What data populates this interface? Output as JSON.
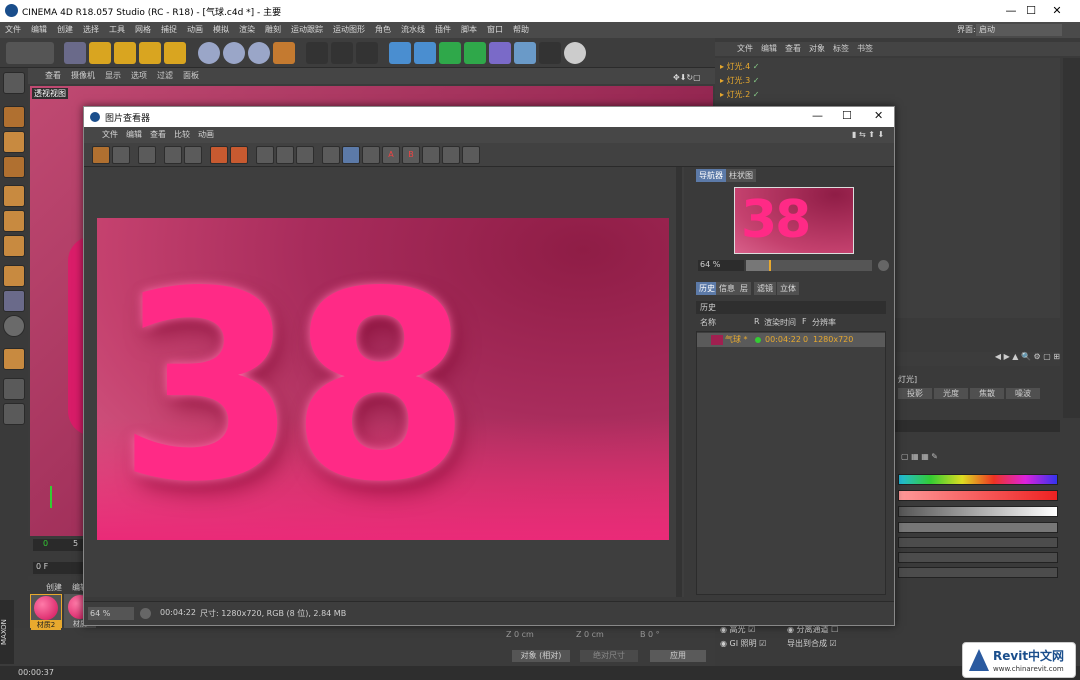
{
  "window": {
    "title": "CINEMA 4D R18.057 Studio (RC - R18) - [气球.c4d *] - 主要",
    "minimize": "—",
    "maximize": "☐",
    "close": "✕"
  },
  "menubar": {
    "items": [
      "文件",
      "编辑",
      "创建",
      "选择",
      "工具",
      "网格",
      "捕捉",
      "动画",
      "模拟",
      "渲染",
      "雕刻",
      "运动跟踪",
      "运动图形",
      "角色",
      "流水线",
      "插件",
      "脚本",
      "窗口",
      "帮助"
    ],
    "interface_label": "界面:",
    "interface_value": "启动"
  },
  "viewport": {
    "menu": [
      "查看",
      "摄像机",
      "显示",
      "选项",
      "过滤",
      "面板"
    ],
    "label": "透视视图"
  },
  "object_manager": {
    "menu": [
      "文件",
      "编辑",
      "查看",
      "对象",
      "标签",
      "书签"
    ],
    "objects": [
      "灯光.4",
      "灯光.3",
      "灯光.2"
    ]
  },
  "picture_viewer": {
    "title": "图片查看器",
    "menu": [
      "文件",
      "编辑",
      "查看",
      "比较",
      "动画"
    ],
    "nav_tabs": [
      "导航器",
      "柱状图"
    ],
    "zoom": "64 %",
    "info_tabs": [
      "历史",
      "信息",
      "层",
      "滤镜",
      "立体"
    ],
    "history_label": "历史",
    "history_columns": [
      "名称",
      "R",
      "渲染时间",
      "F",
      "分辨率"
    ],
    "history_row": {
      "name": "气球 *",
      "time": "00:04:22",
      "frame": "0",
      "resolution": "1280x720"
    },
    "status_zoom": "64 %",
    "status_time": "00:04:22",
    "status_info": "尺寸: 1280x720, RGB (8 位), 2.84 MB",
    "render_text": "38"
  },
  "attributes": {
    "header": "灯光]",
    "tabs": [
      "投影",
      "光度",
      "焦散",
      "噪波"
    ]
  },
  "timeline": {
    "start": "0",
    "end": "5",
    "frame": "0 F"
  },
  "materials": {
    "menu": [
      "创建",
      "编辑"
    ],
    "items": [
      "材质2",
      "材质"
    ]
  },
  "coords": {
    "z1": "Z  0 cm",
    "z2": "Z  0 cm",
    "b": "B  0 °",
    "mode": "对象 (相对)",
    "size": "绝对尺寸",
    "apply": "应用"
  },
  "render_settings": {
    "options": [
      "高光",
      "GI 照明",
      "分离通道",
      "导出到合成"
    ]
  },
  "status": {
    "time": "00:00:37"
  },
  "watermark": {
    "brand": "Revit中文网",
    "url": "www.chinarevit.com"
  },
  "side_tabs": [
    "对象",
    "内容浏览器",
    "构造",
    "属性",
    "层"
  ],
  "colors": {
    "accent": "#5c7aa8",
    "object_label": "#e8a92e",
    "render_pink": "#e0186a"
  }
}
